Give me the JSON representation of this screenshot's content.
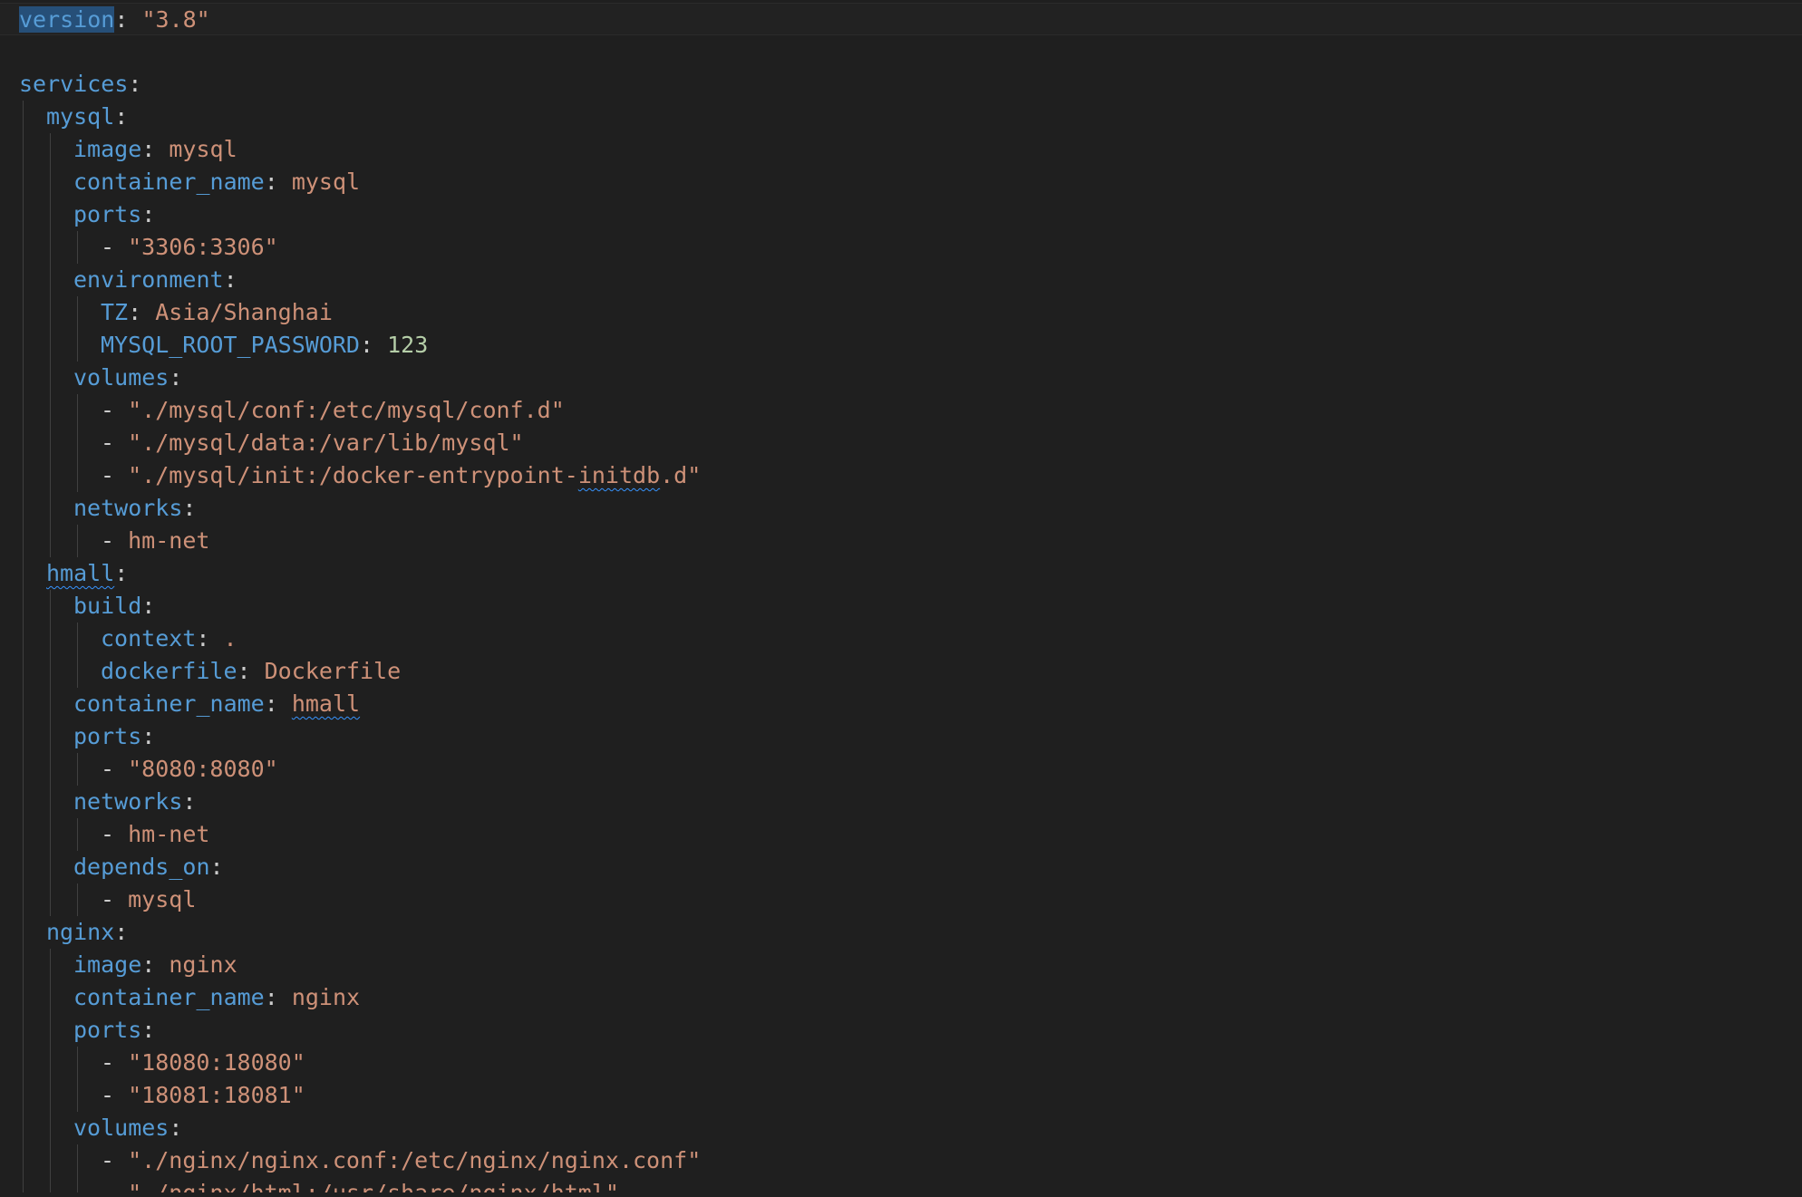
{
  "editor": {
    "language": "yaml",
    "lines": [
      [
        {
          "t": "version",
          "c": "k",
          "sel": true
        },
        {
          "t": ": ",
          "c": "p"
        },
        {
          "t": "\"3.8\"",
          "c": "s"
        }
      ],
      [],
      [
        {
          "t": "services",
          "c": "k"
        },
        {
          "t": ":",
          "c": "p"
        }
      ],
      [
        {
          "t": "mysql",
          "c": "k"
        },
        {
          "t": ":",
          "c": "p"
        }
      ],
      [
        {
          "t": "image",
          "c": "k"
        },
        {
          "t": ": ",
          "c": "p"
        },
        {
          "t": "mysql",
          "c": "s"
        }
      ],
      [
        {
          "t": "container_name",
          "c": "k"
        },
        {
          "t": ": ",
          "c": "p"
        },
        {
          "t": "mysql",
          "c": "s"
        }
      ],
      [
        {
          "t": "ports",
          "c": "k"
        },
        {
          "t": ":",
          "c": "p"
        }
      ],
      [
        {
          "t": "- ",
          "c": "p"
        },
        {
          "t": "\"3306:3306\"",
          "c": "s"
        }
      ],
      [
        {
          "t": "environment",
          "c": "k"
        },
        {
          "t": ":",
          "c": "p"
        }
      ],
      [
        {
          "t": "TZ",
          "c": "k"
        },
        {
          "t": ": ",
          "c": "p"
        },
        {
          "t": "Asia/Shanghai",
          "c": "s"
        }
      ],
      [
        {
          "t": "MYSQL_ROOT_PASSWORD",
          "c": "k"
        },
        {
          "t": ": ",
          "c": "p"
        },
        {
          "t": "123",
          "c": "n"
        }
      ],
      [
        {
          "t": "volumes",
          "c": "k"
        },
        {
          "t": ":",
          "c": "p"
        }
      ],
      [
        {
          "t": "- ",
          "c": "p"
        },
        {
          "t": "\"./mysql/conf:/etc/mysql/conf.d\"",
          "c": "s"
        }
      ],
      [
        {
          "t": "- ",
          "c": "p"
        },
        {
          "t": "\"./mysql/data:/var/lib/mysql\"",
          "c": "s"
        }
      ],
      [
        {
          "t": "- ",
          "c": "p"
        },
        {
          "t": "\"./mysql/init:/docker-entrypoint-",
          "c": "s"
        },
        {
          "t": "initdb",
          "c": "s",
          "squig": true
        },
        {
          "t": ".d\"",
          "c": "s"
        }
      ],
      [
        {
          "t": "networks",
          "c": "k"
        },
        {
          "t": ":",
          "c": "p"
        }
      ],
      [
        {
          "t": "- ",
          "c": "p"
        },
        {
          "t": "hm-net",
          "c": "s"
        }
      ],
      [
        {
          "t": "hmall",
          "c": "k",
          "squig": true
        },
        {
          "t": ":",
          "c": "p"
        }
      ],
      [
        {
          "t": "build",
          "c": "k"
        },
        {
          "t": ":",
          "c": "p"
        }
      ],
      [
        {
          "t": "context",
          "c": "k"
        },
        {
          "t": ": ",
          "c": "p"
        },
        {
          "t": ".",
          "c": "s"
        }
      ],
      [
        {
          "t": "dockerfile",
          "c": "k"
        },
        {
          "t": ": ",
          "c": "p"
        },
        {
          "t": "Dockerfile",
          "c": "s"
        }
      ],
      [
        {
          "t": "container_name",
          "c": "k"
        },
        {
          "t": ": ",
          "c": "p"
        },
        {
          "t": "hmall",
          "c": "s",
          "squig": true
        }
      ],
      [
        {
          "t": "ports",
          "c": "k"
        },
        {
          "t": ":",
          "c": "p"
        }
      ],
      [
        {
          "t": "- ",
          "c": "p"
        },
        {
          "t": "\"8080:8080\"",
          "c": "s"
        }
      ],
      [
        {
          "t": "networks",
          "c": "k"
        },
        {
          "t": ":",
          "c": "p"
        }
      ],
      [
        {
          "t": "- ",
          "c": "p"
        },
        {
          "t": "hm-net",
          "c": "s"
        }
      ],
      [
        {
          "t": "depends_on",
          "c": "k"
        },
        {
          "t": ":",
          "c": "p"
        }
      ],
      [
        {
          "t": "- ",
          "c": "p"
        },
        {
          "t": "mysql",
          "c": "s"
        }
      ],
      [
        {
          "t": "nginx",
          "c": "k"
        },
        {
          "t": ":",
          "c": "p"
        }
      ],
      [
        {
          "t": "image",
          "c": "k"
        },
        {
          "t": ": ",
          "c": "p"
        },
        {
          "t": "nginx",
          "c": "s"
        }
      ],
      [
        {
          "t": "container_name",
          "c": "k"
        },
        {
          "t": ": ",
          "c": "p"
        },
        {
          "t": "nginx",
          "c": "s"
        }
      ],
      [
        {
          "t": "ports",
          "c": "k"
        },
        {
          "t": ":",
          "c": "p"
        }
      ],
      [
        {
          "t": "- ",
          "c": "p"
        },
        {
          "t": "\"18080:18080\"",
          "c": "s"
        }
      ],
      [
        {
          "t": "- ",
          "c": "p"
        },
        {
          "t": "\"18081:18081\"",
          "c": "s"
        }
      ],
      [
        {
          "t": "volumes",
          "c": "k"
        },
        {
          "t": ":",
          "c": "p"
        }
      ],
      [
        {
          "t": "- ",
          "c": "p"
        },
        {
          "t": "\"./nginx/nginx.conf:/etc/nginx/nginx.conf\"",
          "c": "s"
        }
      ],
      [
        {
          "t": "- ",
          "c": "p"
        },
        {
          "t": "\"./nginx/html:/usr/share/nginx/html\"",
          "c": "s"
        }
      ]
    ]
  },
  "colors": {
    "background": "#1f1f1f",
    "key": "#569cd6",
    "string": "#ce9178",
    "number": "#b5cea8",
    "punctuation": "#cccccc",
    "selection": "#264f78",
    "indent_guide": "#404040",
    "squiggle": "#3794ff"
  }
}
